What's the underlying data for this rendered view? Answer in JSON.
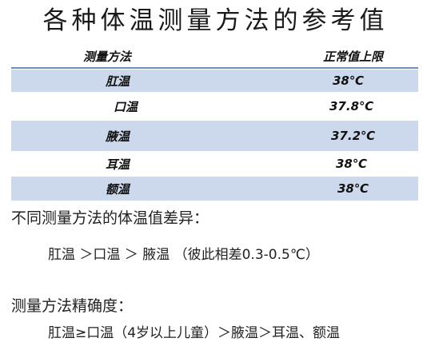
{
  "title": "各种体温测量方法的参考值",
  "table": {
    "header": {
      "method": "测量方法",
      "limit": "正常值上限"
    },
    "rows": [
      {
        "method": "肛温",
        "limit": "38℃"
      },
      {
        "method": "口温",
        "limit": "37.8℃"
      },
      {
        "method": "腋温",
        "limit": "37.2℃"
      },
      {
        "method": "耳温",
        "limit": "38℃"
      },
      {
        "method": "额温",
        "limit": "38℃"
      }
    ]
  },
  "section1": {
    "heading": "不同测量方法的体温值差异：",
    "text": "肛温 ＞口温 ＞ 腋温  （彼此相差0.3-0.5℃）"
  },
  "section2": {
    "heading": "测量方法精确度：",
    "text": "肛温≥口温（4岁以上儿童）＞腋温＞耳温、额温"
  },
  "colors": {
    "row_shade": "#ccd9ec",
    "header_rule": "#6f8fb8"
  }
}
